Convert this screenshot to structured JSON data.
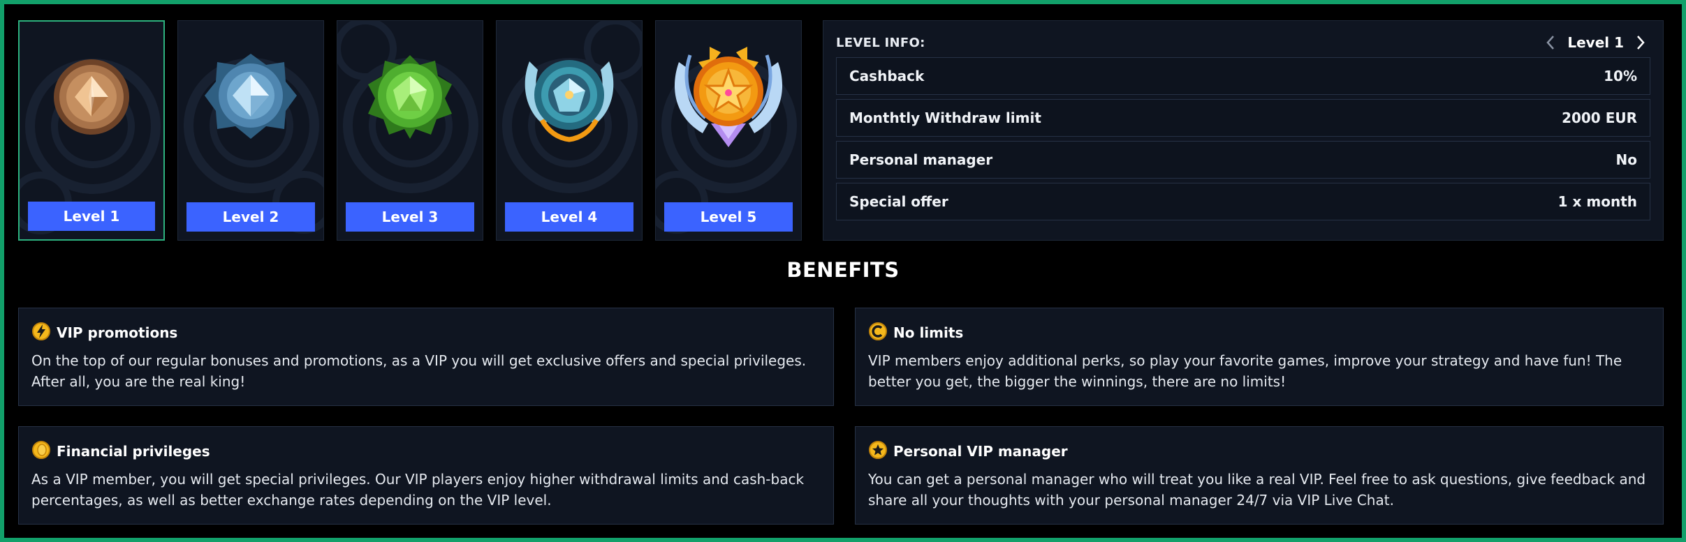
{
  "levels": [
    {
      "label": "Level 1",
      "icon": "bronze-medal-icon",
      "color": "#a8734a",
      "active": true
    },
    {
      "label": "Level 2",
      "icon": "silver-blue-medal-icon",
      "color": "#4f86b0"
    },
    {
      "label": "Level 3",
      "icon": "green-medal-icon",
      "color": "#4fae2f"
    },
    {
      "label": "Level 4",
      "icon": "teal-winged-medal-icon",
      "color": "#3d9cb0"
    },
    {
      "label": "Level 5",
      "icon": "gold-star-medal-icon",
      "color": "#f39a12"
    }
  ],
  "level_info": {
    "title": "LEVEL INFO:",
    "current_level": "Level 1",
    "rows": [
      {
        "label": "Cashback",
        "value": "10%"
      },
      {
        "label": "Monthtly Withdraw limit",
        "value": "2000 EUR"
      },
      {
        "label": "Personal manager",
        "value": "No"
      },
      {
        "label": "Special offer",
        "value": "1 x month"
      }
    ]
  },
  "benefits": {
    "title": "BENEFITS",
    "items": [
      {
        "title": "VIP promotions",
        "icon": "lightning-coin-icon",
        "text": "On the top of our regular bonuses and promotions, as a VIP you will get exclusive offers and special privileges. After all, you are the real king!"
      },
      {
        "title": "No limits",
        "icon": "coin-c-icon",
        "text": "VIP members enjoy additional perks, so play your favorite games, improve your strategy and have fun! The better you get, the bigger the winnings, there are no limits!"
      },
      {
        "title": "Financial privileges",
        "icon": "coin-icon",
        "text": "As a VIP member, you will get special privileges. Our VIP players enjoy higher withdrawal limits and cash-back percentages, as well as better exchange rates depending on the VIP level."
      },
      {
        "title": "Personal VIP manager",
        "icon": "star-coin-icon",
        "text": "You can get a personal manager who will treat you like a real VIP. Feel free to ask questions, give feedback and share all your thoughts with your personal manager 24/7 via VIP Live Chat."
      }
    ]
  },
  "colors": {
    "accent_button": "#3b63ff",
    "active_border": "#2db37f",
    "frame_border": "#12a06a",
    "coin": "#f5b81c"
  }
}
